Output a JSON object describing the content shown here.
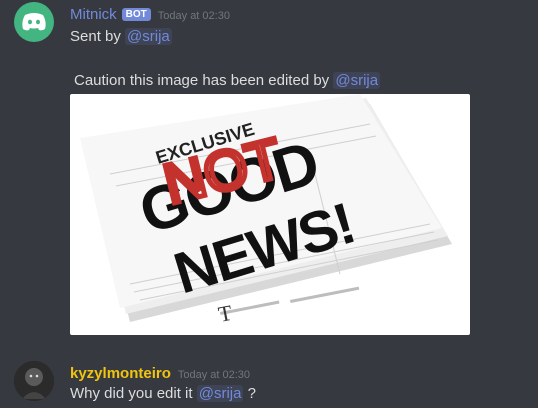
{
  "messages": {
    "bot": {
      "username": "Mitnick",
      "username_color": "#7289da",
      "badge": "BOT",
      "timestamp": "Today at 02:30",
      "line1_prefix": "Sent by",
      "line1_mention": "@srija",
      "caption_prefix": "Caution this image has been edited by",
      "caption_mention": "@srija",
      "image": {
        "headline_top": "EXCLUSIVE",
        "headline_main_1": "GOOD",
        "headline_main_2": "NEWS!",
        "scribble": "NOT",
        "scribble_color": "#c3322d"
      }
    },
    "user": {
      "username": "kyzylmonteiro",
      "username_color": "#f1c40f",
      "timestamp": "Today at 02:30",
      "text_prefix": "Why did you edit it",
      "text_mention": "@srija",
      "text_suffix": "?"
    }
  },
  "icons": {
    "bot_avatar": "discord-logo-icon",
    "user_avatar": "user-photo-avatar"
  }
}
